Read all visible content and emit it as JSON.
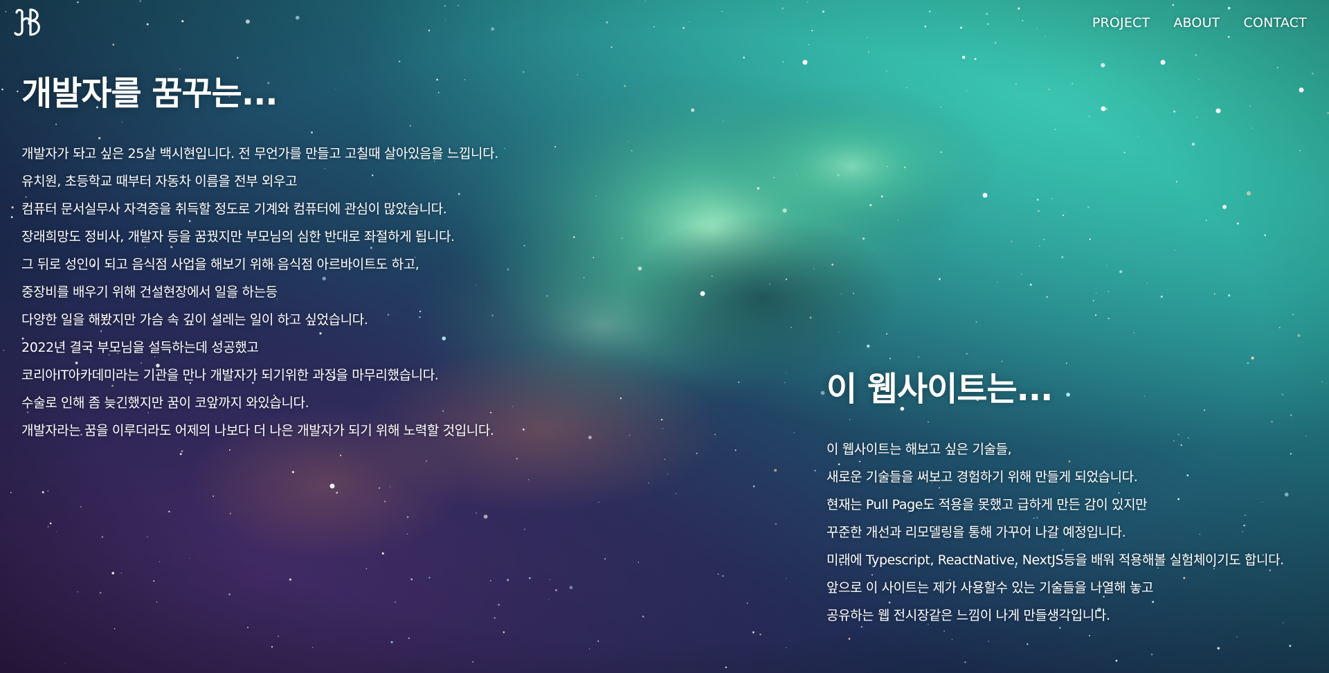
{
  "header": {
    "logo_alt": "HB",
    "nav": [
      {
        "label": "PROJECT"
      },
      {
        "label": "ABOUT"
      },
      {
        "label": "CONTACT"
      }
    ]
  },
  "intro": {
    "title": "개발자를 꿈꾸는...",
    "lines": [
      "개발자가 되고 싶은 25살 백시현입니다. 전 무언가를 만들고 고칠때 살아있음을 느낍니다.",
      "유치원, 초등학교 때부터 자동차 이름을 전부 외우고",
      "컴퓨터 문서실무사 자격증을 취득할 정도로 기계와 컴퓨터에 관심이 많았습니다.",
      "장래희망도 정비사, 개발자 등을 꿈꿨지만 부모님의 심한 반대로 좌절하게 됩니다.",
      "그 뒤로 성인이 되고 음식점 사업을 해보기 위해 음식점 아르바이트도 하고,",
      "중장비를 배우기 위해 건설현장에서 일을 하는등",
      "다양한 일을 해봤지만 가슴 속 깊이 설레는 일이 하고 싶었습니다.",
      "2022년 결국 부모님을 설득하는데 성공했고",
      "코리아IT아카데미라는 기관을 만나 개발자가 되기위한 과정을 마무리했습니다.",
      "수술로 인해 좀 늦긴했지만 꿈이 코앞까지 와있습니다.",
      "개발자라는 꿈을 이루더라도 어제의 나보다 더 나은 개발자가 되기 위해 노력할 것입니다."
    ]
  },
  "about_site": {
    "title": "이 웹사이트는...",
    "lines": [
      "이 웹사이트는 해보고 싶은 기술들,",
      "새로운 기술들을 써보고 경험하기 위해 만들게 되었습니다.",
      "현재는 Pull Page도 적용을 못했고 급하게 만든 감이 있지만",
      "꾸준한 개선과 리모델링을 통해 가꾸어 나갈 예정입니다.",
      "미래에 Typescript, ReactNative, NextJS등을 배워 적용해볼 실험체이기도 합니다.",
      "앞으로 이 사이트는 제가 사용할수 있는 기술들을 나열해 놓고",
      "공유하는 웹 전시장같은 느낌이 나게 만들생각입니다."
    ]
  },
  "colors": {
    "text": "#ffffff",
    "bg_deep": "#1c1838",
    "bg_teal": "#2aa39a",
    "nebula": "#7de3b0"
  }
}
